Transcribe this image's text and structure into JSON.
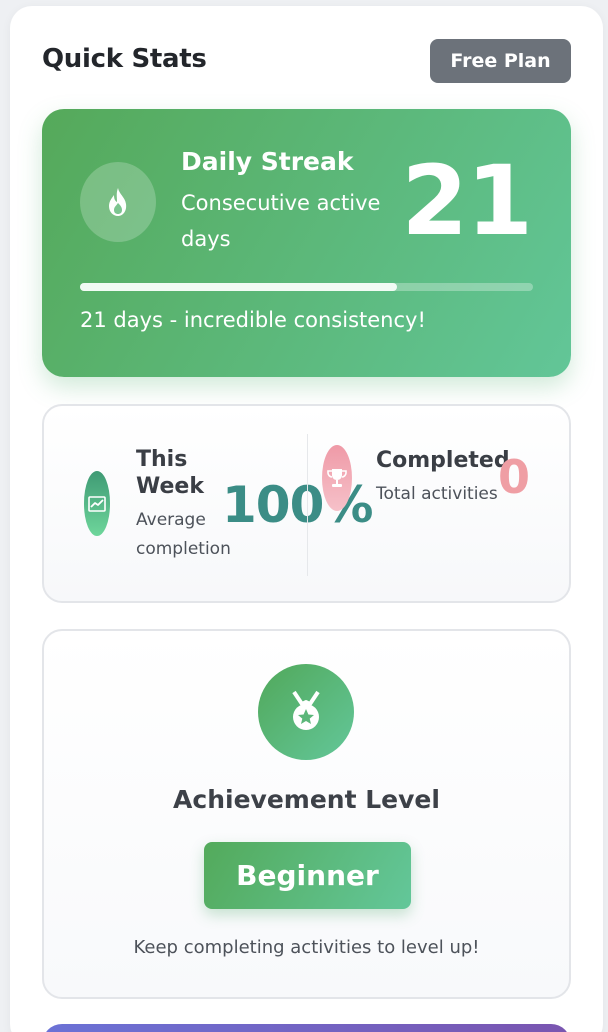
{
  "header": {
    "title": "Quick Stats",
    "plan_badge": "Free Plan"
  },
  "streak": {
    "title": "Daily Streak",
    "subtitle": "Consecutive active days",
    "value": "21",
    "progress": 0.7,
    "message": "21 days - incredible consistency!",
    "icon": "fire-icon"
  },
  "stats": {
    "week": {
      "title": "This Week",
      "subtitle": "Average completion",
      "value": "100%",
      "icon": "chart-line-icon"
    },
    "completed": {
      "title": "Completed",
      "subtitle": "Total activities",
      "value": "0",
      "icon": "trophy-icon"
    }
  },
  "achievement": {
    "title": "Achievement Level",
    "level": "Beginner",
    "hint": "Keep completing activities to level up!",
    "icon": "medal-icon"
  },
  "colors": {
    "streak_gradient_start": "#55a95a",
    "streak_gradient_end": "#62c698",
    "week_value": "#3b8d86",
    "completed_value": "#ef9ea4",
    "plan_badge_bg": "#6c727a"
  }
}
